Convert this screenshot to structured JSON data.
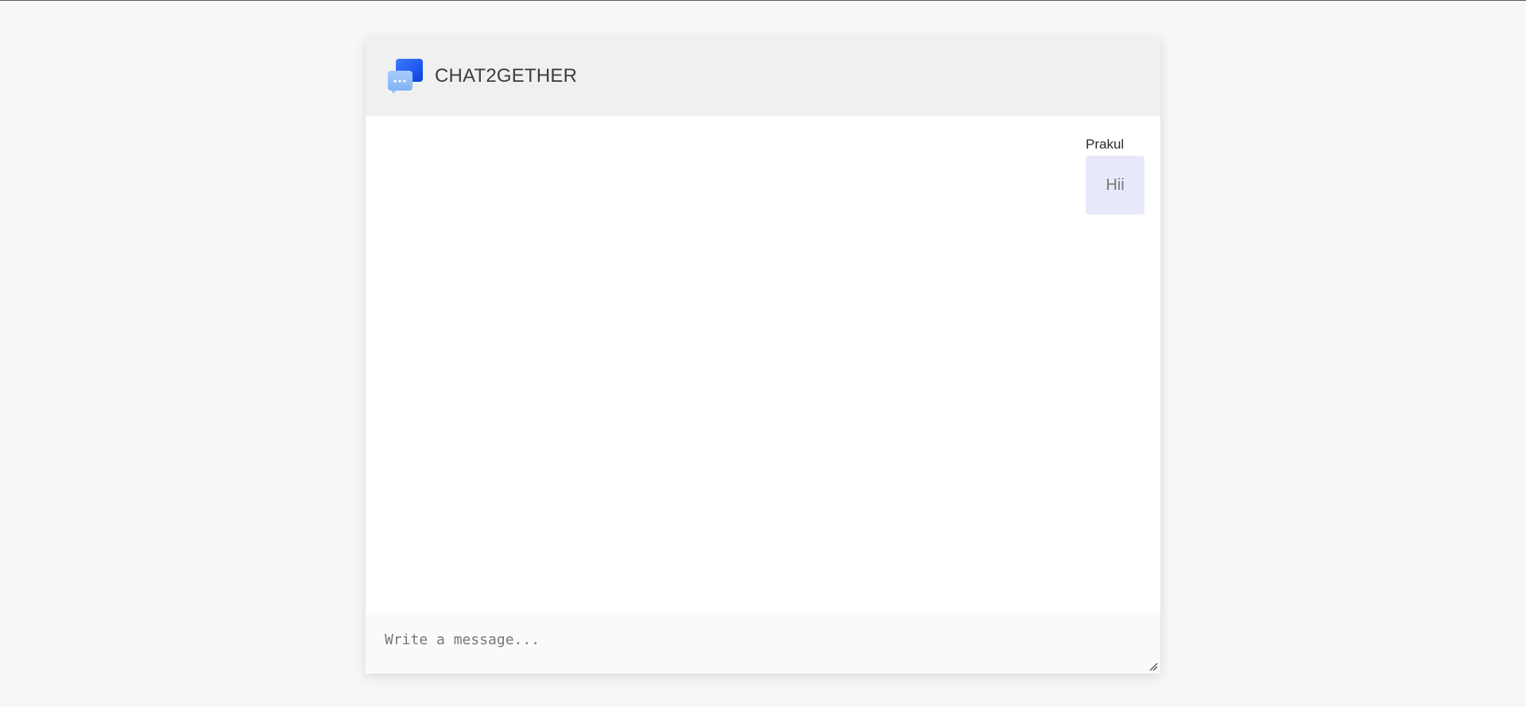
{
  "app": {
    "title": "CHAT2GETHER",
    "logo_icon": "chat-bubbles-icon",
    "accent_color": "#1a56f0"
  },
  "messages": [
    {
      "sender": "Prakul",
      "text": "Hii",
      "bubble_color": "#e8e8fb"
    }
  ],
  "composer": {
    "placeholder": "Write a message...",
    "value": ""
  }
}
